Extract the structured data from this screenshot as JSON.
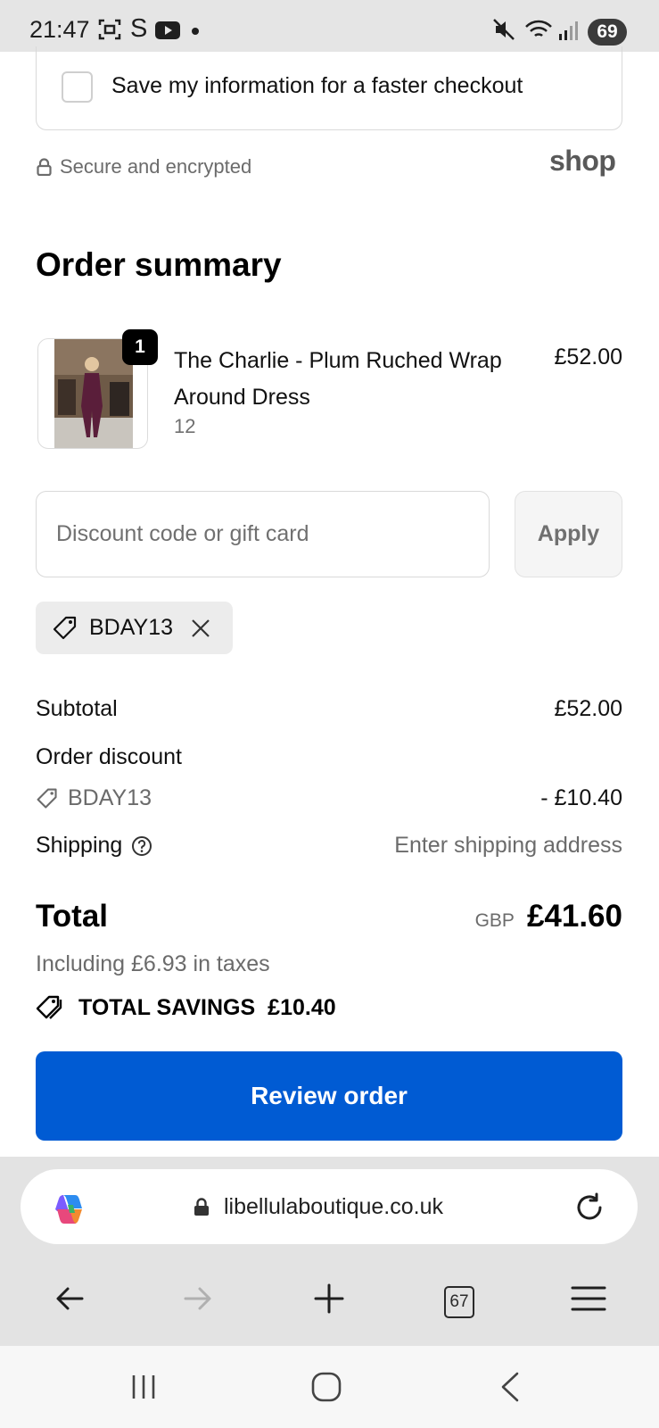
{
  "status_bar": {
    "time": "21:47",
    "notification_icons": [
      "screenshot-icon",
      "s-app-icon",
      "youtube-icon",
      "dot"
    ],
    "s_glyph": "S",
    "system_icons": [
      "mute-icon",
      "wifi-icon",
      "signal-icon"
    ],
    "battery": "69"
  },
  "save_info": {
    "label": "Save my information for a faster checkout",
    "checked": false
  },
  "secure_text": "Secure and encrypted",
  "shop_logo": "shop",
  "order_summary": {
    "title": "Order summary",
    "items": [
      {
        "quantity": "1",
        "name": "The Charlie - Plum Ruched Wrap Around Dress",
        "variant": "12",
        "price": "£52.00"
      }
    ]
  },
  "discount": {
    "placeholder": "Discount code or gift card",
    "value": "",
    "apply_label": "Apply",
    "applied_code": "BDAY13"
  },
  "totals": {
    "subtotal_label": "Subtotal",
    "subtotal_value": "£52.00",
    "order_discount_label": "Order discount",
    "discount_code": "BDAY13",
    "discount_value": "- £10.40",
    "shipping_label": "Shipping",
    "shipping_value": "Enter shipping address",
    "total_label": "Total",
    "currency": "GBP",
    "total_value": "£41.60",
    "taxes_text": "Including £6.93 in taxes",
    "savings_label": "TOTAL SAVINGS",
    "savings_value": "£10.40"
  },
  "review_button": "Review order",
  "browser": {
    "url": "libellulaboutique.co.uk",
    "tab_count": "67"
  },
  "colors": {
    "primary_button": "#005bd3",
    "muted_text": "#6b6b6b",
    "border": "#d9d9d9"
  }
}
